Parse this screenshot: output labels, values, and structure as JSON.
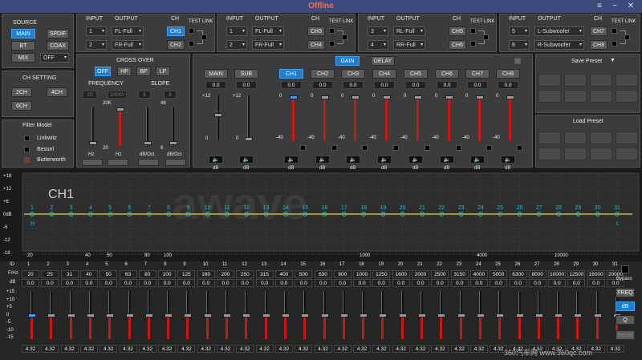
{
  "window": {
    "title": "Offline",
    "menu_icon": "≡",
    "min_icon": "−",
    "close_icon": "✕"
  },
  "source": {
    "title": "SOURCE",
    "main": "MAIN",
    "spdif": "SPDIF",
    "bt": "BT",
    "coax": "COAX",
    "mix": "MIX",
    "off": "OFF"
  },
  "chsetting": {
    "title": "CH SETTING",
    "ch2": "2CH",
    "ch4": "4CH",
    "ch6": "6CH"
  },
  "filter": {
    "title": "Filter Model",
    "items": [
      "Linkwitz",
      "Bessel",
      "Butterworth"
    ]
  },
  "routing": {
    "input_h": "INPUT",
    "output_h": "OUTPUT",
    "ch_h": "CH",
    "test_h": "TEST",
    "link_h": "LINK",
    "groups": [
      {
        "in1": "1",
        "in2": "2",
        "out1": "FL-Full",
        "out2": "FR-Full",
        "ch1": "CH1",
        "ch2": "CH2"
      },
      {
        "in1": "1",
        "in2": "2",
        "out1": "FL-Full",
        "out2": "FR-Full",
        "ch1": "CH3",
        "ch2": "CH4"
      },
      {
        "in1": "3",
        "in2": "4",
        "out1": "RL-Full",
        "out2": "RR-Full",
        "ch1": "CH5",
        "ch2": "CH6"
      },
      {
        "in1": "5",
        "in2": "6",
        "out1": "L-Subwoofer",
        "out2": "R-Subwoofer",
        "ch1": "CH7",
        "ch2": "CH8"
      }
    ]
  },
  "crossover": {
    "title": "CROSS OVER",
    "off": "OFF",
    "hp": "HP",
    "bp": "BP",
    "lp": "LP",
    "freq_h": "FREQUENCY",
    "slope_h": "SLOPE",
    "f1": "20",
    "f2": "20000",
    "s1": "6",
    "s2": "6",
    "top1": "20K",
    "top2": "48",
    "bot1": "20",
    "bot2": "6",
    "hz": "Hz",
    "dboct": "dB/Oct"
  },
  "gainpanel": {
    "gain": "GAIN",
    "delay": "DELAY",
    "channels": [
      "MAIN",
      "SUB",
      "CH1",
      "CH2",
      "CH3",
      "CH4",
      "CH5",
      "CH6",
      "CH7",
      "CH8"
    ],
    "value": "0.0",
    "db": "dB",
    "p12": "+12",
    "zero": "0",
    "m40": "-40",
    "spk": "🔈"
  },
  "presets": {
    "save": "Save Preset",
    "load": "Load Preset"
  },
  "graph": {
    "label": "CH1",
    "logo": "awave",
    "yticks": [
      "+18",
      "+12",
      "+6",
      "0dB",
      "-6",
      "-12",
      "-18"
    ],
    "xticks": [
      "20",
      "40",
      "50",
      "80",
      "100",
      "1000",
      "4000",
      "10000"
    ],
    "h": "H",
    "l": "L",
    "points": [
      "1",
      "2",
      "3",
      "4",
      "5",
      "6",
      "7",
      "8",
      "9",
      "10",
      "11",
      "12",
      "13",
      "14",
      "15",
      "16",
      "17",
      "18",
      "19",
      "20",
      "21",
      "22",
      "23",
      "24",
      "25",
      "26",
      "27",
      "28",
      "29",
      "30",
      "31"
    ]
  },
  "eq": {
    "id_h": "ID",
    "fhz_h": "F/Hz",
    "db_h": "dB",
    "ids": [
      "1",
      "2",
      "3",
      "4",
      "5",
      "6",
      "7",
      "8",
      "9",
      "10",
      "11",
      "12",
      "13",
      "14",
      "15",
      "16",
      "17",
      "18",
      "19",
      "20",
      "21",
      "22",
      "23",
      "24",
      "25",
      "26",
      "27",
      "28",
      "29",
      "30",
      "31"
    ],
    "freqs": [
      "20",
      "25",
      "31",
      "40",
      "50",
      "63",
      "80",
      "100",
      "125",
      "160",
      "200",
      "250",
      "315",
      "400",
      "500",
      "630",
      "800",
      "1000",
      "1250",
      "1600",
      "2000",
      "2500",
      "3150",
      "4000",
      "5000",
      "6300",
      "8000",
      "10000",
      "12500",
      "16000",
      "20000"
    ],
    "dbval": "0.0",
    "qval": "4.32",
    "scale": [
      "+15",
      "+10",
      "+5",
      "0",
      "-5",
      "-10",
      "-15"
    ],
    "bypass": "Bypass",
    "freq": "FREQ",
    "db": "dB",
    "q": "Q",
    "reset": "Reset"
  },
  "watermark": "360汽车网 www.360qc.com",
  "colors": {
    "accent": "#1d7fd0",
    "title": "#ff6b4a",
    "eqline": "#c8b838",
    "point": "#2ab6c8"
  }
}
